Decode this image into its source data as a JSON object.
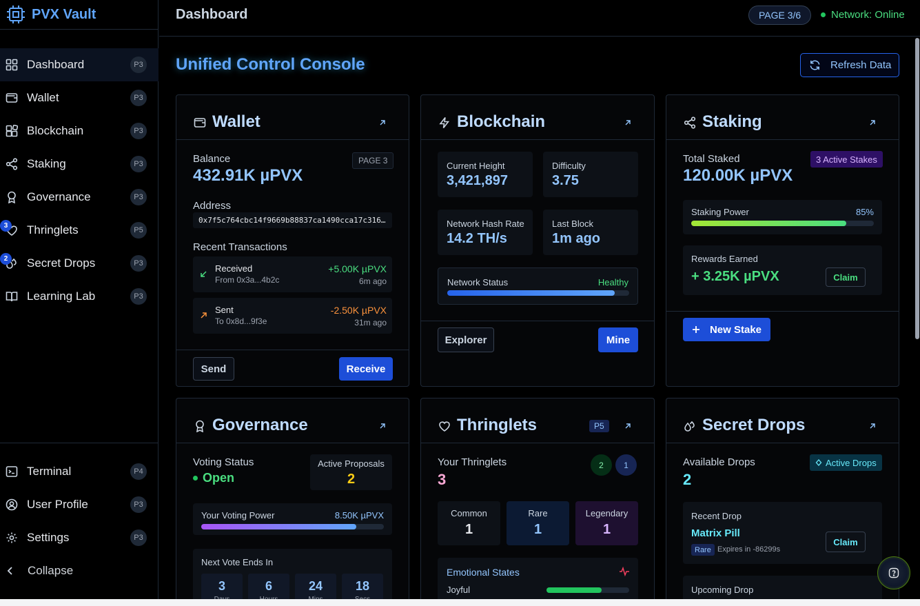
{
  "app": {
    "name": "PVX Vault"
  },
  "sidebar": {
    "items": [
      {
        "label": "Dashboard",
        "page": "P3"
      },
      {
        "label": "Wallet",
        "page": "P3"
      },
      {
        "label": "Blockchain",
        "page": "P3"
      },
      {
        "label": "Staking",
        "page": "P3"
      },
      {
        "label": "Governance",
        "page": "P3"
      },
      {
        "label": "Thringlets",
        "page": "P5",
        "badge": "3"
      },
      {
        "label": "Secret Drops",
        "page": "P3",
        "badge": "2"
      },
      {
        "label": "Learning Lab",
        "page": "P3"
      }
    ],
    "bottom": [
      {
        "label": "Terminal",
        "page": "P4"
      },
      {
        "label": "User Profile",
        "page": "P3"
      },
      {
        "label": "Settings",
        "page": "P3"
      }
    ],
    "collapse_label": "Collapse"
  },
  "header": {
    "title": "Dashboard",
    "page_indicator": "PAGE 3/6",
    "network_status": "Network: Online"
  },
  "main": {
    "title": "Unified Control Console",
    "refresh_label": "Refresh Data"
  },
  "wallet": {
    "title": "Wallet",
    "balance_label": "Balance",
    "page_badge": "PAGE 3",
    "balance": "432.91K µPVX",
    "address_label": "Address",
    "address": "0x7f5c764cbc14f9669b88837ca1490cca17c316…",
    "recent_label": "Recent Transactions",
    "transactions": [
      {
        "type": "Received",
        "party": "From 0x3a...4b2c",
        "amount": "+5.00K µPVX",
        "time": "6m ago",
        "color": "#4ade80"
      },
      {
        "type": "Sent",
        "party": "To 0x8d...9f3e",
        "amount": "-2.50K µPVX",
        "time": "31m ago",
        "color": "#fb923c"
      }
    ],
    "send_label": "Send",
    "receive_label": "Receive"
  },
  "blockchain": {
    "title": "Blockchain",
    "stats": [
      {
        "label": "Current Height",
        "value": "3,421,897"
      },
      {
        "label": "Difficulty",
        "value": "3.75"
      },
      {
        "label": "Network Hash Rate",
        "value": "14.2 TH/s"
      },
      {
        "label": "Last Block",
        "value": "1m ago"
      }
    ],
    "network_status_label": "Network Status",
    "network_status_value": "Healthy",
    "network_health": 0.92,
    "explorer_label": "Explorer",
    "mine_label": "Mine"
  },
  "staking": {
    "title": "Staking",
    "total_label": "Total Staked",
    "active_badge": "3 Active Stakes",
    "total": "120.00K µPVX",
    "power_label": "Staking Power",
    "power_pct": "85%",
    "power": 0.85,
    "rewards_label": "Rewards Earned",
    "rewards": "+ 3.25K µPVX",
    "claim_label": "Claim",
    "new_stake_label": "New Stake"
  },
  "governance": {
    "title": "Governance",
    "voting_status_label": "Voting Status",
    "voting_status": "Open",
    "active_proposals_label": "Active Proposals",
    "active_proposals": "2",
    "voting_power_label": "Your Voting Power",
    "voting_power": "8.50K µPVX",
    "voting_power_fraction": 0.85,
    "next_vote_label": "Next Vote Ends In",
    "countdown": [
      {
        "value": "3",
        "unit": "Days"
      },
      {
        "value": "6",
        "unit": "Hours"
      },
      {
        "value": "24",
        "unit": "Mins"
      },
      {
        "value": "18",
        "unit": "Secs"
      }
    ]
  },
  "thringlets": {
    "title": "Thringlets",
    "page_badge": "P5",
    "yours_label": "Your Thringlets",
    "count": "3",
    "badge_a": "2",
    "badge_b": "1",
    "rarities": [
      {
        "label": "Common",
        "value": "1",
        "color": "#e5e7eb"
      },
      {
        "label": "Rare",
        "value": "1",
        "color": "#93c5fd"
      },
      {
        "label": "Legendary",
        "value": "1",
        "color": "#d8b4fe"
      }
    ],
    "emotional_label": "Emotional States",
    "emotions": [
      {
        "label": "Joyful",
        "level": 0.67
      }
    ]
  },
  "secret_drops": {
    "title": "Secret Drops",
    "available_label": "Available Drops",
    "active_badge": "Active Drops",
    "available": "2",
    "recent_label": "Recent Drop",
    "recent_name": "Matrix Pill",
    "rarity": "Rare",
    "expires": "Expires in -86299s",
    "claim_label": "Claim",
    "upcoming_label": "Upcoming Drop"
  },
  "colors": {
    "accent": "#1d4ed8",
    "link": "#60a5fa",
    "positive": "#4ade80",
    "negative": "#fb923c"
  }
}
